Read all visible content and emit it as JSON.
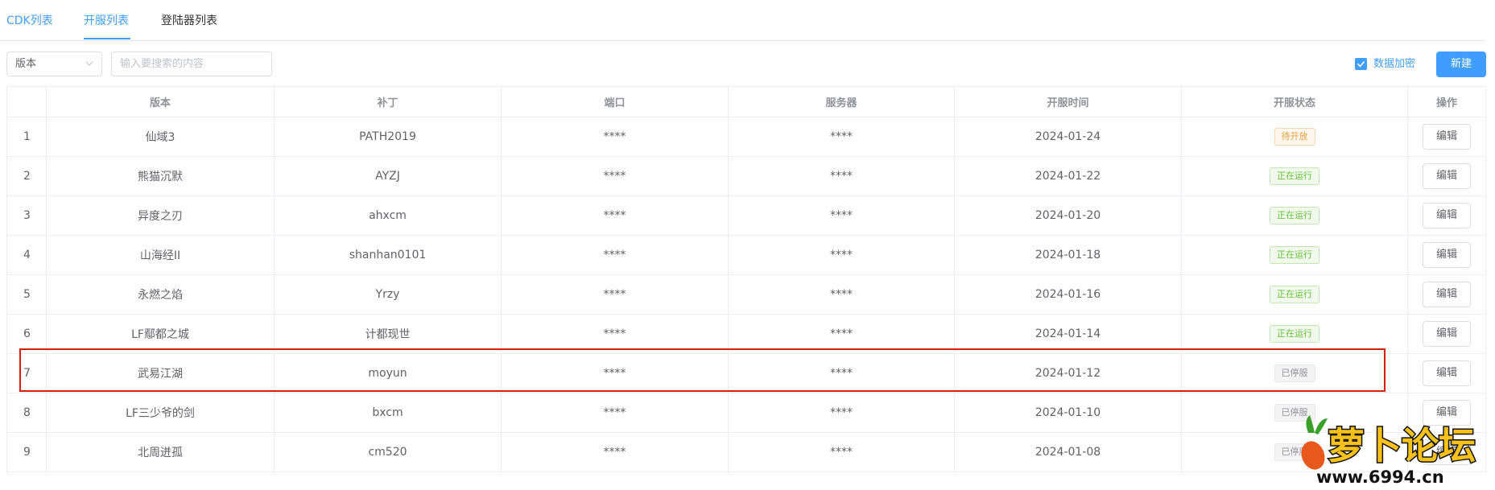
{
  "tabs": [
    "CDK列表",
    "开服列表",
    "登陆器列表"
  ],
  "toolbar": {
    "version_select": "版本",
    "search_placeholder": "输入要搜索的内容",
    "encrypt_label": "数据加密",
    "new_button": "新建"
  },
  "table": {
    "columns": [
      "",
      "版本",
      "补丁",
      "端口",
      "服务器",
      "开服时间",
      "开服状态",
      "操作"
    ],
    "rows": [
      {
        "idx": "1",
        "version": "仙域3",
        "patch": "PATH2019",
        "port": "****",
        "server": "****",
        "date": "2024-01-24",
        "status": "待开放",
        "status_kind": "wait",
        "action": "编辑"
      },
      {
        "idx": "2",
        "version": "熊猫沉默",
        "patch": "AYZJ",
        "port": "****",
        "server": "****",
        "date": "2024-01-22",
        "status": "正在运行",
        "status_kind": "run",
        "action": "编辑"
      },
      {
        "idx": "3",
        "version": "异度之刃",
        "patch": "ahxcm",
        "port": "****",
        "server": "****",
        "date": "2024-01-20",
        "status": "正在运行",
        "status_kind": "run",
        "action": "编辑"
      },
      {
        "idx": "4",
        "version": "山海经II",
        "patch": "shanhan0101",
        "port": "****",
        "server": "****",
        "date": "2024-01-18",
        "status": "正在运行",
        "status_kind": "run",
        "action": "编辑"
      },
      {
        "idx": "5",
        "version": "永燃之焰",
        "patch": "Yrzy",
        "port": "****",
        "server": "****",
        "date": "2024-01-16",
        "status": "正在运行",
        "status_kind": "run",
        "action": "编辑"
      },
      {
        "idx": "6",
        "version": "LF鄢都之城",
        "patch": "计都现世",
        "port": "****",
        "server": "****",
        "date": "2024-01-14",
        "status": "正在运行",
        "status_kind": "run",
        "action": "编辑"
      },
      {
        "idx": "7",
        "version": "武易江湖",
        "patch": "moyun",
        "port": "****",
        "server": "****",
        "date": "2024-01-12",
        "status": "已停服",
        "status_kind": "stop",
        "action": "编辑"
      },
      {
        "idx": "8",
        "version": "LF三少爷的剑",
        "patch": "bxcm",
        "port": "****",
        "server": "****",
        "date": "2024-01-10",
        "status": "已停服",
        "status_kind": "stop",
        "action": "编辑"
      },
      {
        "idx": "9",
        "version": "北周迸孤",
        "patch": "cm520",
        "port": "****",
        "server": "****",
        "date": "2024-01-08",
        "status": "已停服",
        "status_kind": "stop",
        "action": "编辑"
      }
    ]
  },
  "watermark": {
    "title": "萝卜论坛",
    "url": "www.6994.cn"
  },
  "colors": {
    "accent": "#409eff",
    "highlight": "#d81e06",
    "wait": "#e6a23c",
    "run": "#67c23a",
    "stop": "#909399"
  },
  "icons": {
    "select": "chevron-down-icon",
    "checkbox": "checkmark-icon"
  }
}
